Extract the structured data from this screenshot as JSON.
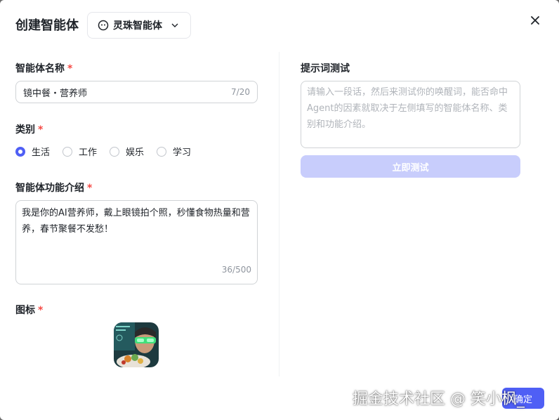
{
  "header": {
    "title": "创建智能体",
    "model_name": "灵珠智能体"
  },
  "form": {
    "name_label": "智能体名称",
    "required_mark": "*",
    "name_value": "镜中餐・营养师",
    "name_counter": "7/20",
    "category_label": "类别",
    "categories": [
      {
        "label": "生活",
        "selected": true
      },
      {
        "label": "工作",
        "selected": false
      },
      {
        "label": "娱乐",
        "selected": false
      },
      {
        "label": "学习",
        "selected": false
      }
    ],
    "desc_label": "智能体功能介绍",
    "desc_value": "我是你的AI营养师，戴上眼镜拍个照，秒懂食物热量和营养，春节聚餐不发愁！",
    "desc_counter": "36/500",
    "icon_label": "图标"
  },
  "test": {
    "label": "提示词测试",
    "placeholder": "请输入一段话，然后来测试你的唤醒词，能否命中Agent的因素就取决于左侧填写的智能体名称、类别和功能介绍。",
    "button": "立即测试"
  },
  "footer": {
    "confirm_button": "确定"
  },
  "watermark": "掘金技术社区 @ 笑小枫_",
  "colors": {
    "accent": "#4f5ff5",
    "accent_disabled": "#c8cdfc",
    "required": "#f54a45"
  }
}
